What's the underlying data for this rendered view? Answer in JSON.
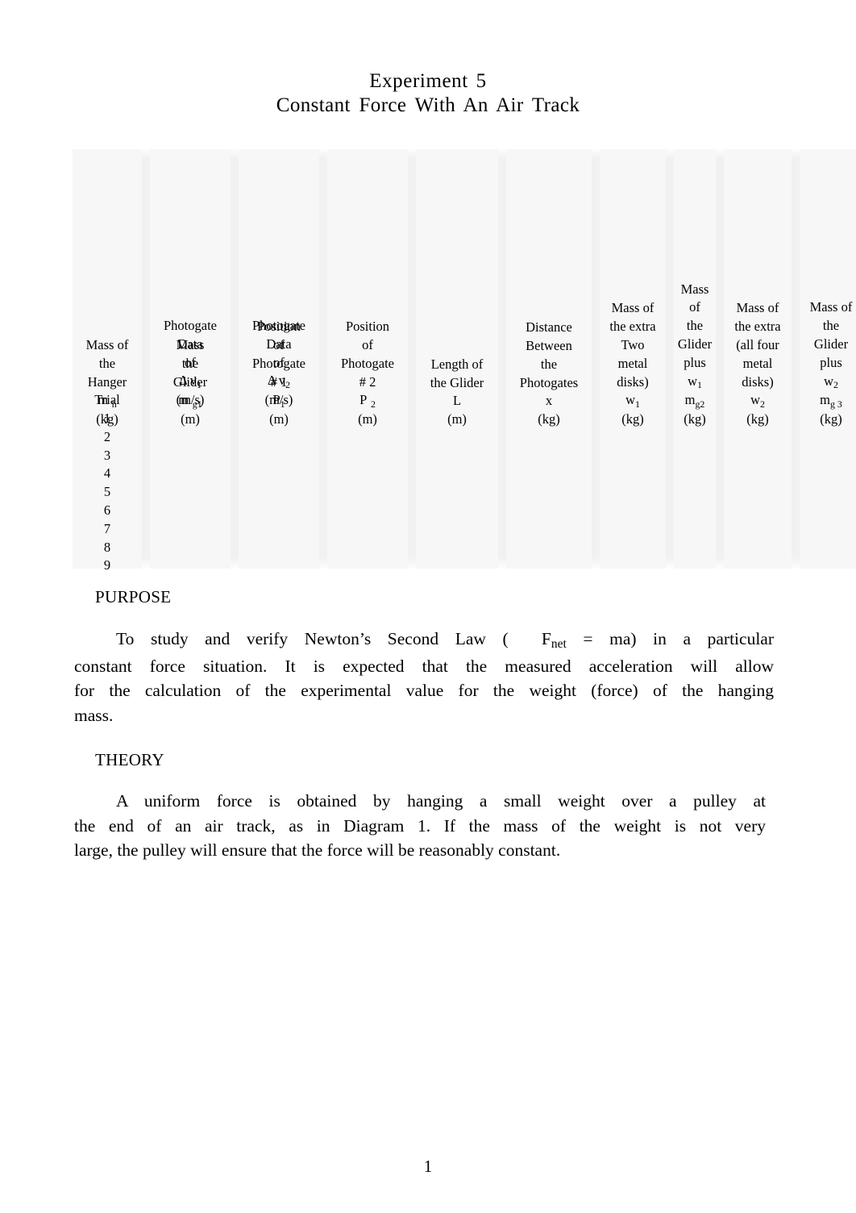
{
  "document": {
    "title_line1": "Experiment  5",
    "title_line2": "Constant  Force  With  An  Air  Track",
    "page_number": "1"
  },
  "data_table": {
    "columns": [
      {
        "id": "mass-hanger",
        "header_lines": [
          "Mass of",
          "the",
          "Hanger"
        ],
        "symbol": "m",
        "symbol_sub": "h",
        "unit": "(kg)"
      },
      {
        "id": "mass-glider",
        "header_lines": [
          "Mass",
          "the",
          "Glider"
        ],
        "symbol": "m",
        "symbol_sub": "g1",
        "unit": "(m)"
      },
      {
        "id": "position-photogate-1",
        "header_lines": [
          "Position",
          "of",
          "Photogate",
          "# 1"
        ],
        "symbol": "P",
        "symbol_sub": "1",
        "unit": "(m)"
      },
      {
        "id": "position-photogate-2",
        "header_lines": [
          "Position",
          "of",
          "Photogate",
          "# 2"
        ],
        "symbol": "P",
        "symbol_sub": "2",
        "unit": "(m)"
      },
      {
        "id": "length-glider",
        "header_lines": [
          "Length of",
          "the Glider"
        ],
        "symbol": "L",
        "symbol_sub": "",
        "unit": "(m)"
      },
      {
        "id": "distance-between-photogates",
        "header_lines": [
          "Distance",
          "Between",
          "the",
          "Photogates"
        ],
        "symbol": "x",
        "symbol_sub": "",
        "unit": "(kg)"
      },
      {
        "id": "mass-extra-two-disks",
        "header_lines": [
          "Mass of",
          "the extra",
          "Two",
          "metal",
          "disks)"
        ],
        "symbol": "w",
        "symbol_sub": "1",
        "unit": "(kg)"
      },
      {
        "id": "mass-glider-plus-w1",
        "header_lines": [
          "Mass of",
          "the",
          "Glider",
          "plus"
        ],
        "symbol_top": "w",
        "symbol_top_sub": "1",
        "symbol": "m",
        "symbol_sub": "g2",
        "unit": "(kg)"
      },
      {
        "id": "mass-extra-four-disks",
        "header_lines": [
          "Mass of",
          "the extra",
          "(all four",
          "metal",
          "disks)"
        ],
        "symbol": "w",
        "symbol_sub": "2",
        "unit": "(kg)"
      },
      {
        "id": "mass-glider-plus-w2",
        "header_lines": [
          "Mass of",
          "the",
          "Glider",
          "plus"
        ],
        "symbol_top": "w",
        "symbol_top_sub": "2",
        "symbol": "m",
        "symbol_sub": "g 3",
        "unit": "(kg)"
      }
    ],
    "secondary_header": {
      "trial_label": "Trial",
      "photogate1_lines": [
        "Photogate",
        "Data",
        "of"
      ],
      "photogate1_symbol_pre": "Δ v",
      "photogate1_symbol_sub": "1",
      "photogate1_unit": "(m/s)",
      "photogate2_lines": [
        "Photogate",
        "Data",
        "of"
      ],
      "photogate2_symbol_pre": "Δ v",
      "photogate2_symbol_sub": "2",
      "photogate2_unit": "(m/s)"
    },
    "trials": [
      "1",
      "2",
      "3",
      "4",
      "5",
      "6",
      "7",
      "8",
      "9"
    ]
  },
  "sections": {
    "purpose": {
      "heading": "PURPOSE",
      "text_part1": "To study and verify Newton’s Second Law (",
      "formula_f": "F",
      "formula_sub": "net",
      "formula_rest": "=  ma",
      "text_part2": ") in a particular",
      "line2": "constant force situation. It is expected that the measured acceleration will allow",
      "line3": "for the calculation of the experimental value for the weight (force) of the hanging",
      "line4": "mass."
    },
    "theory": {
      "heading": "THEORY",
      "line1": "A uniform force is obtained by hanging a small weight over a pulley at",
      "line2": "the end of an air track, as in Diagram 1. If the mass of the weight is not very",
      "line3": "large, the pulley will ensure that the force will be reasonably constant."
    }
  }
}
